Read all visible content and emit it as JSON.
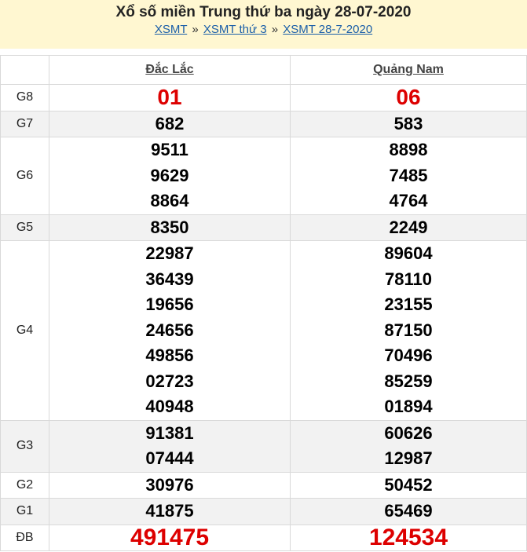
{
  "header": {
    "title": "Xổ số miền Trung thứ ba ngày 28-07-2020",
    "breadcrumbs": [
      "XSMT",
      "XSMT thứ 3",
      "XSMT 28-7-2020"
    ],
    "separator": "»"
  },
  "provinces": [
    "Đắc Lắc",
    "Quảng Nam"
  ],
  "prizes": [
    {
      "label": "G8",
      "style": "red",
      "values": [
        [
          "01"
        ],
        [
          "06"
        ]
      ]
    },
    {
      "label": "G7",
      "style": "normal",
      "values": [
        [
          "682"
        ],
        [
          "583"
        ]
      ]
    },
    {
      "label": "G6",
      "style": "normal",
      "values": [
        [
          "9511",
          "9629",
          "8864"
        ],
        [
          "8898",
          "7485",
          "4764"
        ]
      ]
    },
    {
      "label": "G5",
      "style": "normal",
      "values": [
        [
          "8350"
        ],
        [
          "2249"
        ]
      ]
    },
    {
      "label": "G4",
      "style": "normal",
      "values": [
        [
          "22987",
          "36439",
          "19656",
          "24656",
          "49856",
          "02723",
          "40948"
        ],
        [
          "89604",
          "78110",
          "23155",
          "87150",
          "70496",
          "85259",
          "01894"
        ]
      ]
    },
    {
      "label": "G3",
      "style": "normal",
      "values": [
        [
          "91381",
          "07444"
        ],
        [
          "60626",
          "12987"
        ]
      ]
    },
    {
      "label": "G2",
      "style": "normal",
      "values": [
        [
          "30976"
        ],
        [
          "50452"
        ]
      ]
    },
    {
      "label": "G1",
      "style": "normal",
      "values": [
        [
          "41875"
        ],
        [
          "65469"
        ]
      ]
    },
    {
      "label": "ĐB",
      "style": "big",
      "values": [
        [
          "491475"
        ],
        [
          "124534"
        ]
      ]
    }
  ],
  "colors": {
    "header_bg": "#fff7d1",
    "alt_row": "#f2f2f2",
    "prize_red": "#dd0000",
    "link": "#1a5ea8"
  }
}
